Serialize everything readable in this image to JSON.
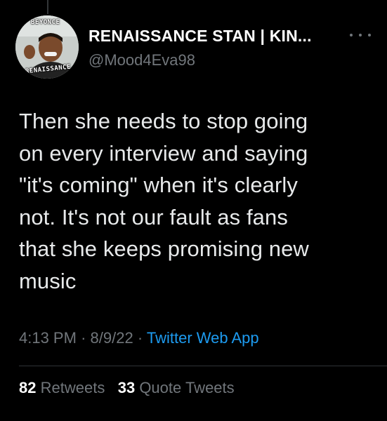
{
  "author": {
    "display_name": "RENAISSANCE STAN | KIN...",
    "handle": "@Mood4Eva98",
    "avatar_text_top": "BEYONCE",
    "avatar_text_bottom": "RENAISSANCE"
  },
  "tweet": {
    "text": "Then she needs to stop going\non every interview and saying\n\"it's coming\" when it's clearly\nnot. It's not our fault as fans\nthat she keeps promising new\nmusic",
    "time": "4:13 PM",
    "date": "8/9/22",
    "source": "Twitter Web App"
  },
  "stats": {
    "retweets_count": "82",
    "retweets_label": "Retweets",
    "quotes_count": "33",
    "quotes_label": "Quote Tweets"
  },
  "icons": {
    "more": "more-horizontal-icon"
  },
  "colors": {
    "background": "#000000",
    "text": "#e7e9ea",
    "muted": "#71767b",
    "link": "#1d9bf0"
  }
}
